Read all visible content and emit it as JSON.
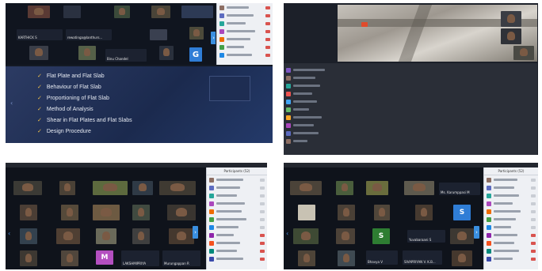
{
  "q1": {
    "participants": [
      "KARTHICK S",
      "rewatinga@lanthurs...",
      "Binu Chandel"
    ],
    "letter_tile": "G"
  },
  "q2": {},
  "slide": {
    "bullets": [
      "Flat Plate and Flat Slab",
      "Behaviour of Flat Slab",
      "Proportioning of Flat Slab",
      "Method of Analysis",
      "Shear in Flat Plates and Flat Slabs",
      "Design Procedure"
    ]
  },
  "q3": {
    "panel_title": "Participants (52)",
    "tile_names": [
      "LAKSHMIPRIYA",
      "Murungappan R"
    ],
    "letter_tile": "M"
  },
  "q4": {
    "panel_title": "Participants (52)",
    "tile_names": [
      "Ms. Karumppasi M",
      "Yuvabaraani S",
      "Bhavya V",
      "SIVAPRIYAN V. K.B..."
    ],
    "letter_tiles": [
      "S",
      "S"
    ]
  },
  "colors": {
    "slide_bg": "#1b2a4e",
    "check": "#f0c14b",
    "tab_blue": "#3a8fe0",
    "mic_muted": "#d9534f"
  }
}
